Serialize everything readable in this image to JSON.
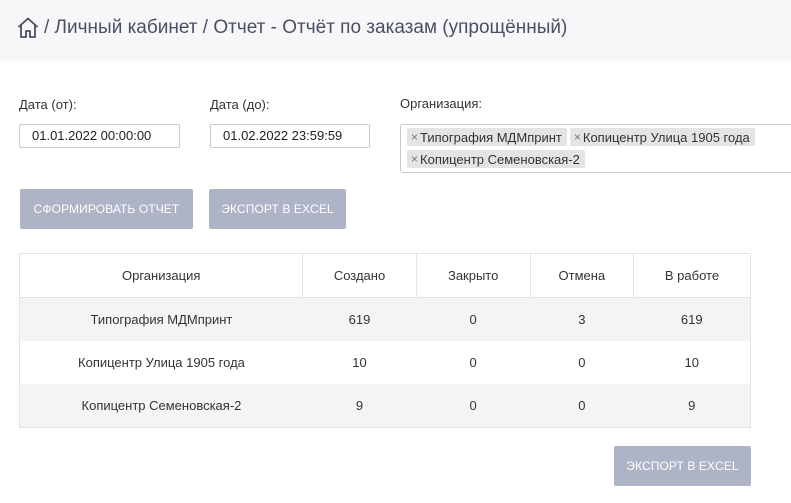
{
  "breadcrumb": {
    "icon": "home-icon",
    "text": "/ Личный кабинет / Отчет - Отчёт по заказам (упрощённый)"
  },
  "filters": {
    "date_from_label": "Дата (от):",
    "date_from_value": "01.01.2022 00:00:00",
    "date_to_label": "Дата (до):",
    "date_to_value": "01.02.2022 23:59:59",
    "org_label": "Организация:",
    "org_selected": [
      "Типография МДМпринт",
      "Копицентр Улица 1905 года",
      "Копицентр Семеновская-2"
    ]
  },
  "buttons": {
    "generate": "СФОРМИРОВАТЬ ОТЧЕТ",
    "export_top": "ЭКСПОРТ В EXCEL",
    "export_bottom": "ЭКСПОРТ В EXCEL"
  },
  "table": {
    "headers": [
      "Организация",
      "Создано",
      "Закрыто",
      "Отмена",
      "В работе"
    ],
    "rows": [
      [
        "Типография МДМпринт",
        "619",
        "0",
        "3",
        "619"
      ],
      [
        "Копицентр Улица 1905 года",
        "10",
        "0",
        "0",
        "10"
      ],
      [
        "Копицентр Семеновская-2",
        "9",
        "0",
        "0",
        "9"
      ]
    ]
  },
  "colors": {
    "button_bg": "#aeb4c6",
    "header_bg": "#f7f7fa",
    "breadcrumb_text": "#4a4f63",
    "row_stripe": "#f4f4f4"
  }
}
